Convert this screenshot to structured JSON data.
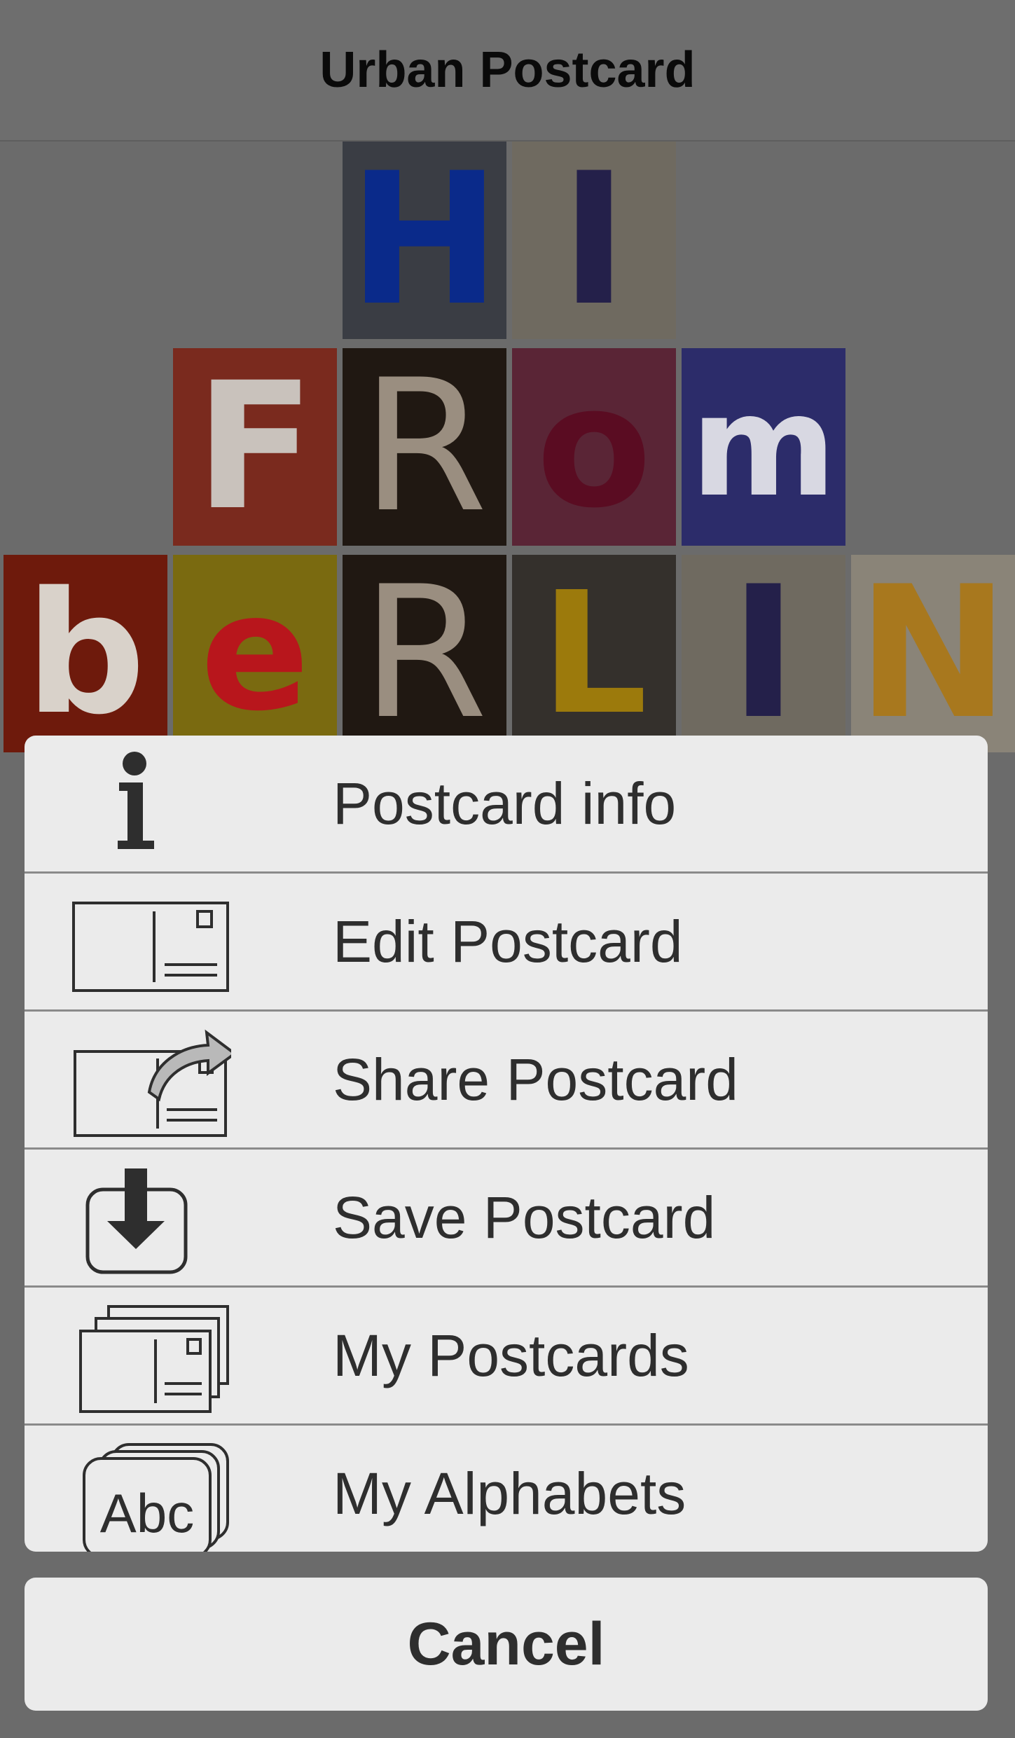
{
  "navbar": {
    "title": "Urban Postcard"
  },
  "postcard": {
    "tiles": [
      {
        "letter": "H",
        "bg": "#3a3d44",
        "fg": "#0a2a8a"
      },
      {
        "letter": "I",
        "bg": "#6f6a60",
        "fg": "#24204a"
      },
      {
        "letter": "F",
        "bg": "#7a2a1e",
        "fg": "#c9c2bc"
      },
      {
        "letter": "R",
        "bg": "#201812",
        "fg": "#9a8e80"
      },
      {
        "letter": "o",
        "bg": "#5a2536",
        "fg": "#5a0c22"
      },
      {
        "letter": "m",
        "bg": "#2c2c6a",
        "fg": "#d8d8e2"
      },
      {
        "letter": "b",
        "bg": "#6e1a0c",
        "fg": "#d9d2ca"
      },
      {
        "letter": "e",
        "bg": "#7a6a10",
        "fg": "#b8161c"
      },
      {
        "letter": "R",
        "bg": "#201812",
        "fg": "#9a8e80"
      },
      {
        "letter": "L",
        "bg": "#34302c",
        "fg": "#9c7a0c"
      },
      {
        "letter": "I",
        "bg": "#6f6a60",
        "fg": "#24204a"
      },
      {
        "letter": "N",
        "bg": "#8a8478",
        "fg": "#a8781e"
      }
    ]
  },
  "menu": {
    "items": [
      {
        "label": "Postcard info",
        "icon": "info-icon"
      },
      {
        "label": "Edit Postcard",
        "icon": "postcard-icon"
      },
      {
        "label": "Share Postcard",
        "icon": "share-postcard-icon"
      },
      {
        "label": "Save Postcard",
        "icon": "save-download-icon"
      },
      {
        "label": "My Postcards",
        "icon": "postcard-stack-icon"
      },
      {
        "label": "My Alphabets",
        "icon": "alphabet-cards-icon"
      }
    ],
    "cancel_label": "Cancel",
    "icon_alphabet_text": "Abc"
  }
}
